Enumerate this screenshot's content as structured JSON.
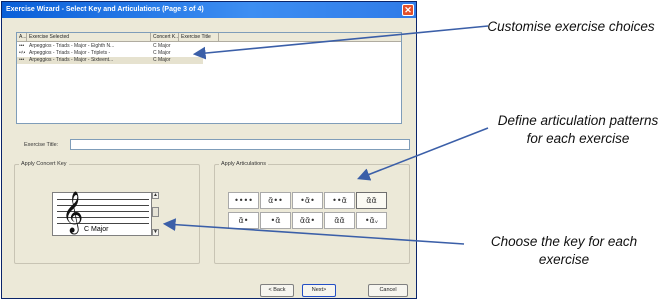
{
  "window": {
    "title": "Exercise Wizard - Select Key and Articulations (Page 3 of 4)",
    "close_glyph": "✕"
  },
  "exercise_list": {
    "columns": [
      "A...",
      "Exercise Selected",
      "Concert K...",
      "Exercise Title"
    ],
    "rows": [
      {
        "icon": "•••",
        "name": "Arpeggios - Triads - Major - Eighth N...",
        "key": "C Major",
        "title": ""
      },
      {
        "icon": "•˄•",
        "name": "Arpeggios - Triads - Major - Triplets -",
        "key": "C Major",
        "title": ""
      },
      {
        "icon": "•••",
        "name": "Arpeggios - Triads - Major - Sixteent...",
        "key": "C Major",
        "title": ""
      }
    ]
  },
  "exercise_title": {
    "label": "Exercise Title:",
    "value": ""
  },
  "concert_key": {
    "group_label": "Apply Concert Key",
    "clef_glyph": "𝄞",
    "selected_key": "C Major",
    "scroll_up": "▲",
    "scroll_down": "▼"
  },
  "articulations": {
    "group_label": "Apply Articulations",
    "rows": [
      [
        "••••",
        "ᾶ••",
        "•ᾶ•",
        "••ᾶ",
        "ᾶᾶ"
      ],
      [
        "ᾶ•",
        "•ᾶ",
        "ᾶᾶ•",
        "ᾶᾶ",
        "•ᾶᵥ"
      ]
    ]
  },
  "buttons": {
    "back": "< Back",
    "next": "Next>",
    "cancel": "Cancel"
  },
  "callouts": {
    "customise": "Customise exercise choices",
    "articulation": "Define articulation patterns for each exercise",
    "key": "Choose the key for each exercise"
  },
  "colors": {
    "arrow": "#3b5fa8",
    "title_bar": "#0a5fd8",
    "close": "#e2502c"
  }
}
